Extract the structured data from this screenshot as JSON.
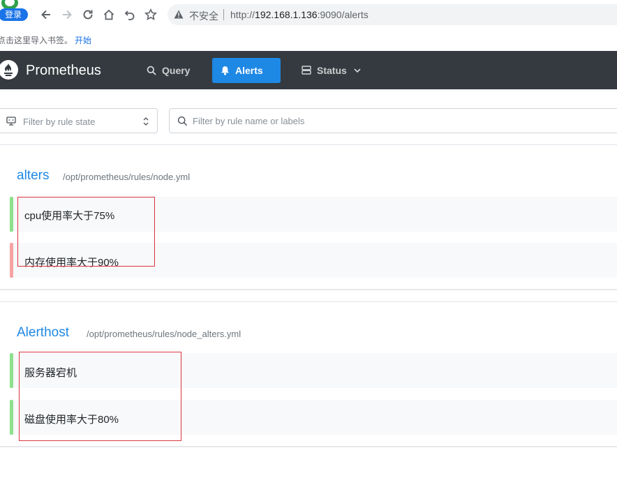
{
  "browser": {
    "login_label": "登录",
    "insecure_label": "不安全",
    "url_scheme": "http://",
    "url_host": "192.168.1.136",
    "url_rest": ":9090/alerts",
    "bookmark_hint": "点击这里导入书签。",
    "bookmark_start": "开始"
  },
  "navbar": {
    "brand": "Prometheus",
    "query_label": "Query",
    "alerts_label": "Alerts",
    "status_label": "Status"
  },
  "filters": {
    "state_placeholder": "Filter by rule state",
    "search_placeholder": "Filter by rule name or labels"
  },
  "groups": [
    {
      "name": "alters",
      "file": "/opt/prometheus/rules/node.yml",
      "rules": [
        {
          "name": "cpu使用率大于75%",
          "state_color": "#8ce08c"
        },
        {
          "name": "内存使用率大于90%",
          "state_color": "#f5a3a3"
        }
      ]
    },
    {
      "name": "Alerthost",
      "file": "/opt/prometheus/rules/node_alters.yml",
      "rules": [
        {
          "name": "服务器宕机",
          "state_color": "#8ce08c"
        },
        {
          "name": "磁盘使用率大于80%",
          "state_color": "#8ce08c"
        }
      ]
    }
  ],
  "colors": {
    "navbar_bg": "#343a40",
    "accent": "#1e88e5",
    "annotation_box": "#d9363e"
  }
}
